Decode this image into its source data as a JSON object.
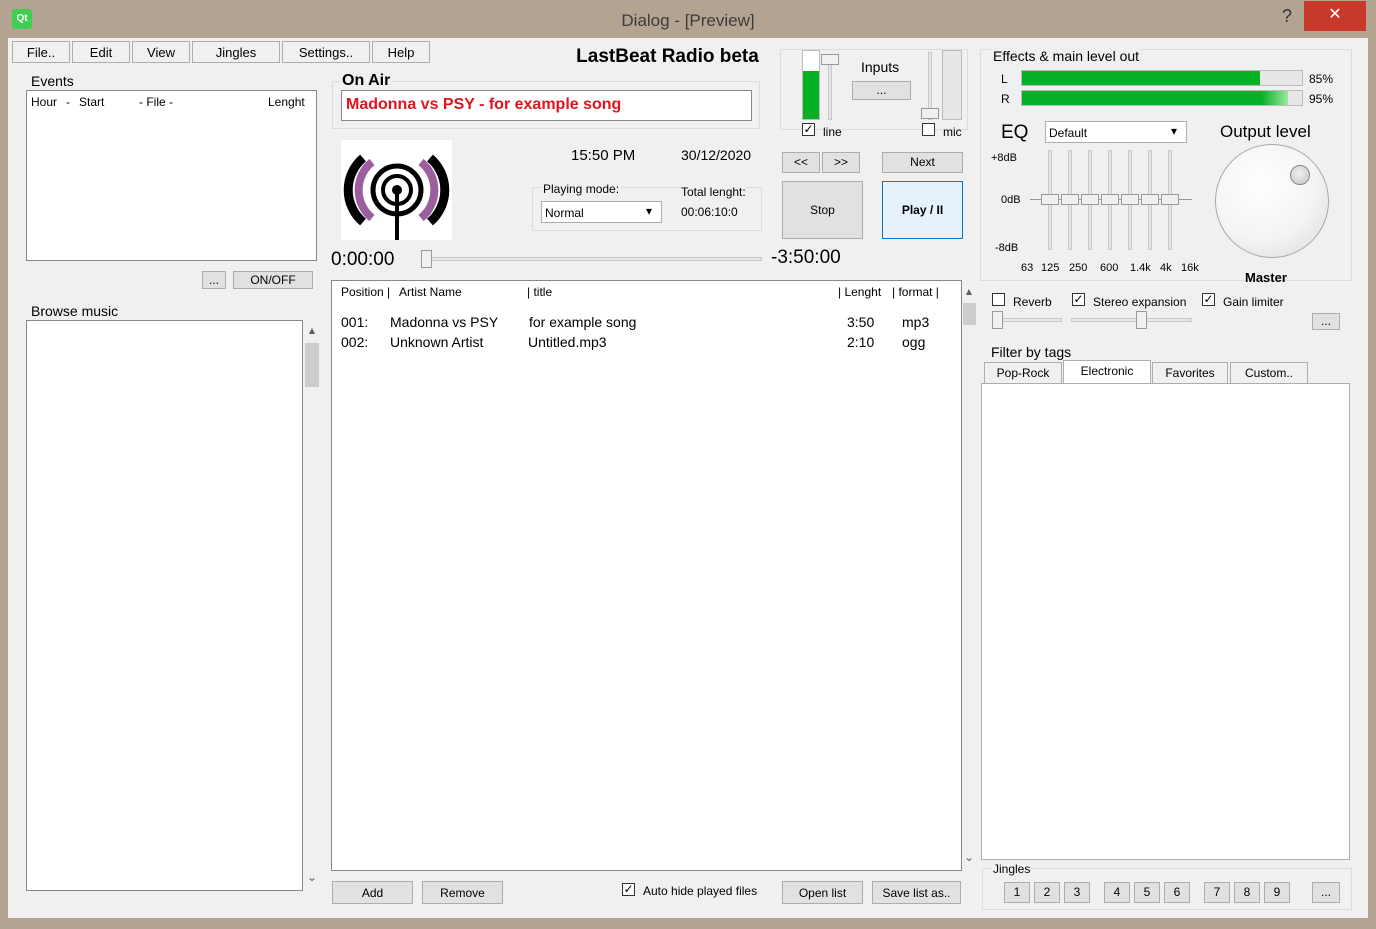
{
  "window": {
    "title": "Dialog - [Preview]",
    "help": "?",
    "close": "✕",
    "logo": "Qt"
  },
  "menu": [
    "File..",
    "Edit",
    "View",
    "Jingles",
    "Settings..",
    "Help"
  ],
  "app_title": "LastBeat Radio beta",
  "events": {
    "label": "Events",
    "header": {
      "hour": "Hour",
      "dash1": "-",
      "start": "Start",
      "file": "- File -",
      "length": "Lenght"
    },
    "more_button": "...",
    "onoff_button": "ON/OFF"
  },
  "browse": {
    "label": "Browse music"
  },
  "on_air": {
    "label": "On Air",
    "now_playing": "Madonna vs PSY - for example song"
  },
  "clock": {
    "time": "15:50 PM",
    "date": "30/12/2020"
  },
  "playing_mode": {
    "label": "Playing mode:",
    "value": "Normal"
  },
  "total_length": {
    "label": "Total lenght:",
    "value": "00:06:10:0"
  },
  "position": {
    "elapsed": "0:00:00",
    "remaining": "-3:50:00",
    "progress": 0
  },
  "playlist": {
    "columns": [
      "Position |",
      "Artist Name",
      "| title",
      "| Lenght",
      "| format |"
    ],
    "rows": [
      {
        "pos": "001:",
        "artist": "Madonna vs PSY",
        "title": "for example song",
        "length": "3:50",
        "format": "mp3"
      },
      {
        "pos": "002:",
        "artist": "Unknown Artist",
        "title": "Untitled.mp3",
        "length": "2:10",
        "format": "ogg"
      }
    ]
  },
  "playlist_buttons": {
    "add": "Add",
    "remove": "Remove",
    "auto_hide": "Auto hide played files",
    "auto_hide_checked": true,
    "open": "Open list",
    "save": "Save list as.."
  },
  "transport": {
    "prev": "<<",
    "next_seek": ">>",
    "next": "Next",
    "stop": "Stop",
    "play": "Play / II"
  },
  "inputs": {
    "label": "Inputs",
    "more": "...",
    "line_label": "line",
    "line_checked": true,
    "mic_label": "mic",
    "mic_checked": false,
    "line_level": 0.7,
    "mic_level": 0
  },
  "effects": {
    "label": "Effects & main level out",
    "left_label": "L",
    "left_value": "85%",
    "left_level": 0.85,
    "right_label": "R",
    "right_value": "95%",
    "right_level": 0.95,
    "eq_label": "EQ",
    "eq_preset": "Default",
    "db_top": "+8dB",
    "db_mid": "0dB",
    "db_bottom": "-8dB",
    "bands": [
      "63",
      "125",
      "250",
      "600",
      "1.4k",
      "4k",
      "16k"
    ],
    "output_label": "Output level",
    "master_label": "Master",
    "reverb": "Reverb",
    "reverb_checked": false,
    "stereo": "Stereo expansion",
    "stereo_checked": true,
    "gain": "Gain limiter",
    "gain_checked": true,
    "more": "..."
  },
  "tags": {
    "label": "Filter by tags",
    "tabs": [
      "Pop-Rock",
      "Electronic",
      "Favorites",
      "Custom.."
    ],
    "active": "Electronic"
  },
  "jingles": {
    "label": "Jingles",
    "buttons": [
      "1",
      "2",
      "3",
      "4",
      "5",
      "6",
      "7",
      "8",
      "9"
    ],
    "more": "..."
  },
  "colors": {
    "accent_green": "#06b025",
    "on_air_red": "#e0141b",
    "logo_purple": "#9b5fa0",
    "close_red": "#c7392b"
  },
  "icons": {
    "scroll_up": "▲",
    "scroll_down": "⌄",
    "dropdown": "▾",
    "check": "✓"
  }
}
